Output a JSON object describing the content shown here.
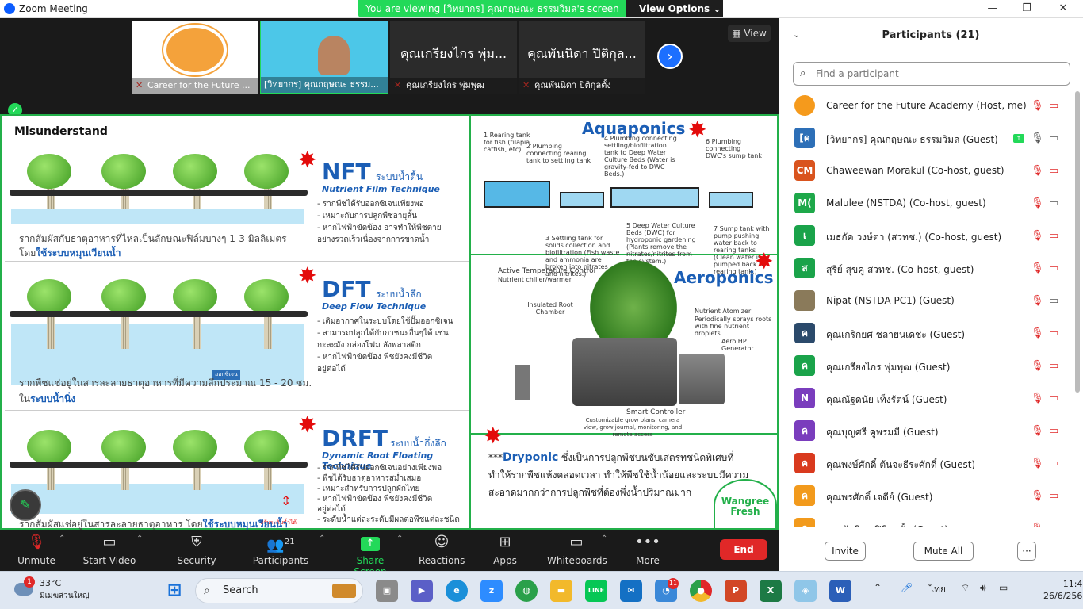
{
  "window": {
    "title": "Zoom Meeting",
    "min": "—",
    "max": "❐",
    "close": "✕"
  },
  "banner": {
    "message": "You are viewing [วิทยากร] คุณกฤษณะ ธรรมวิมล's screen",
    "view_options": "View Options ⌄"
  },
  "thumbnails": [
    {
      "name": "Career for the Future ..."
    },
    {
      "name": "[วิทยากร] คุณกฤษณะ ธรรม..."
    },
    {
      "name": "คุณเกรียงไกร พุ่มพุฒ",
      "big": "คุณเกรียงไกร พุ่ม..."
    },
    {
      "name": "คุณพันนิดา ปิติกุลตั้ง",
      "big": "คุณพันนิดา ปิติกุล..."
    }
  ],
  "view_button": "View",
  "slide": {
    "heading": "Misunderstand",
    "nft": {
      "abbr": "NFT",
      "thai": "ระบบน้ำตื้น",
      "full": "Nutrient Film Technique",
      "bullets": [
        "- รากพืชได้รับออกซิเจนเพียงพอ",
        "- เหมาะกับการปลูกพืชอายุสั้น",
        "- หากไฟฟ้าขัดข้อง อาจทำให้พืชตาย",
        "  อย่างรวดเร็วเนื่องจากการขาดน้ำ"
      ],
      "desc1": "รากสัมผัสกับธาตุอาหารที่ไหลเป็นลักษณะฟิล์มบางๆ 1-3 มิลลิเมตร",
      "desc2_pre": "โดย",
      "desc2_em": "ใช้ระบบหมุนเวียนน้ำ"
    },
    "dft": {
      "abbr": "DFT",
      "thai": "ระบบน้ำลึก",
      "full": "Deep Flow Technique",
      "bullets": [
        "- เติมอากาศในระบบโดยใช้ปั๊มออกซิเจน",
        "- สามารถปลูกได้กับภาชนะอื่นๆได้ เช่น",
        "  กะละมัง กล่องโฟม ลังพลาสติก",
        "- หากไฟฟ้าขัดข้อง พืชยังคงมีชีวิต",
        "  อยู่ต่อได้"
      ],
      "tag": "ออกซิเจน",
      "desc1": "รากพืชแช่อยู่ในสารละลายธาตุอาหารที่มีความลึกประมาณ 15 - 20 ซม.",
      "desc2_pre": "ใน",
      "desc2_em": "ระบบน้ำนิ่ง"
    },
    "drft": {
      "abbr": "DRFT",
      "thai": "ระบบน้ำกึ่งลึก",
      "full": "Dynamic Root Floating Technique",
      "bullets": [
        "- รากพืชได้รับออกซิเจนอย่างเพียงพอ",
        "- พืชได้รับธาตุอาหารสม่ำเสมอ",
        "- เหมาะสำหรับการปลูกผักไทย",
        "- หากไฟฟ้าขัดข้อง พืชยังคงมีชีวิต",
        "  อยู่ต่อได้",
        "- ระดับน้ำแต่ละระดับมีผลต่อพืชแต่ละชนิด"
      ],
      "tag": "ปรับระดับน้ำได้",
      "desc1_pre": "รากสัมผัสแช่อยู่ในสารละลายธาตุอาหาร โดย",
      "desc1_em": "ใช้ระบบหมุนเวียนน้ำ"
    },
    "aquaponics": {
      "title": "Aquaponics",
      "labels": [
        "1 Rearing tank for fish (tilapia, catfish, etc)",
        "2 Plumbing connecting rearing tank to settling tank",
        "4 Plumbing connecting settling/biofiltration tank to Deep Water Culture Beds (Water is gravity-fed to DWC Beds.)",
        "6 Plumbing connecting DWC's sump tank",
        "3 Settling tank for solids collection and biofiltration (Fish waste and ammonia are broken into nitrates and nitrites.)",
        "5 Deep Water Culture Beds (DWC) for hydroponic gardening (Plants remove the nitrates/nitrites from the system.)",
        "7 Sump tank with pump pushing water back to rearing tanks (Clean water is pumped back to rearing tank.)"
      ]
    },
    "aeroponics": {
      "title": "Aeroponics",
      "labels": [
        "Active Temperature Control",
        "Nutrient chiller/warmer",
        "Insulated Root Chamber",
        "Nutrient Atomizer",
        "Periodically sprays roots with fine nutrient droplets",
        "Aero HP Generator",
        "Smart Controller",
        "Customizable grow plans, camera view, grow journal, monitoring, and remote access"
      ]
    },
    "dryponic": {
      "prefix": "***",
      "name": "Dryponic",
      "line1": " ซึ่งเป็นการปลูกพืชบนซับเสตรทชนิดพิเศษที่",
      "line2": "ทำให้รากพืชแห้งตลอดเวลา ทำให้พืชใช้น้ำน้อยและระบบมีความ",
      "line3": "สะอาดมากกว่าการปลูกพืชที่ต้องพึ่งน้ำปริมาณมาก",
      "logo1": "Wangree",
      "logo2": "Fresh"
    }
  },
  "controls": {
    "unmute": "Unmute",
    "video": "Start Video",
    "security": "Security",
    "participants": "Participants",
    "participants_count": "21",
    "share": "Share Screen",
    "reactions": "Reactions",
    "apps": "Apps",
    "whiteboards": "Whiteboards",
    "more": "More",
    "end": "End"
  },
  "panel": {
    "title": "Participants (21)",
    "search_placeholder": "Find a participant",
    "participants": [
      {
        "name": "Career for the Future Academy (Host, me)",
        "initial": "",
        "color": "#f59a1c"
      },
      {
        "name": "[วิทยากร] คุณกฤษณะ ธรรมวิมล (Guest)",
        "initial": "[ค",
        "color": "#2d6fb7"
      },
      {
        "name": "Chaweewan Morakul (Co-host, guest)",
        "initial": "CM",
        "color": "#d9541e"
      },
      {
        "name": "Malulee (NSTDA) (Co-host, guest)",
        "initial": "M(",
        "color": "#1ea84a"
      },
      {
        "name": "เมธกัค วงษ์ตา (สวทช.) (Co-host, guest)",
        "initial": "เ",
        "color": "#1aa34a"
      },
      {
        "name": "สุรีย์ สุขคู สวทช. (Co-host, guest)",
        "initial": "ส",
        "color": "#1aa34a"
      },
      {
        "name": "Nipat (NSTDA PC1) (Guest)",
        "initial": "",
        "color": "#8a7a5a"
      },
      {
        "name": "คุณเกริกยศ ชลายนเดชะ (Guest)",
        "initial": "ค",
        "color": "#2b4a6b"
      },
      {
        "name": "คุณเกรียงไกร พุ่มพุฒ (Guest)",
        "initial": "ค",
        "color": "#1aa34a"
      },
      {
        "name": "คุณณัฐดนัย เท็งรัตน์ (Guest)",
        "initial": "N",
        "color": "#7a3dbd"
      },
      {
        "name": "คุณบุญศรี คูพรมมี (Guest)",
        "initial": "ค",
        "color": "#7a3dbd"
      },
      {
        "name": "คุณพงษ์ศักดิ์ ต้นจะธีระศักดิ์ (Guest)",
        "initial": "ค",
        "color": "#d93a1e"
      },
      {
        "name": "คุณพรศักดิ์ เจดีย์ (Guest)",
        "initial": "ค",
        "color": "#f29a1c"
      },
      {
        "name": "คุณพันนิดา ปิติกุลตั้ง (Guest)",
        "initial": "ค",
        "color": "#f29a1c"
      }
    ],
    "invite": "Invite",
    "mute_all": "Mute All",
    "more": "···"
  },
  "taskbar": {
    "weather_temp": "33°C",
    "weather_desc": "มีเมฆส่วนใหญ่",
    "weather_badge": "1",
    "search": "Search",
    "mail_badge": "11",
    "lang": "ไทย",
    "time": "11:41",
    "date": "26/6/2566"
  }
}
